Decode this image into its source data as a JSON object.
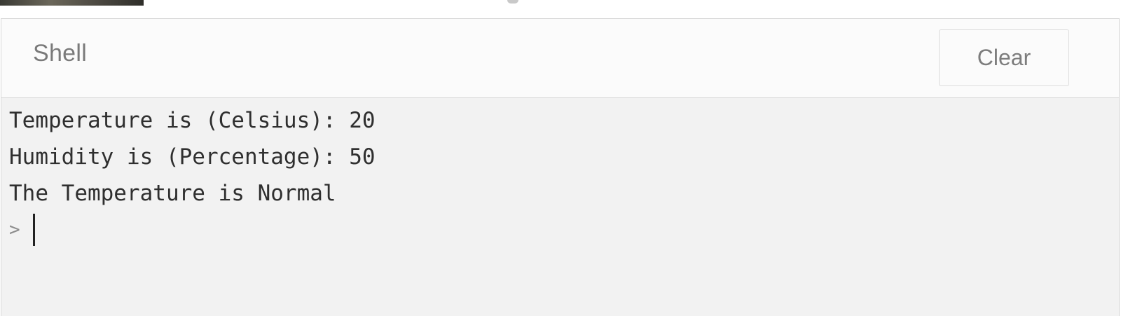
{
  "shell": {
    "title": "Shell",
    "clear_label": "Clear"
  },
  "console": {
    "lines": [
      "Temperature is (Celsius): 20",
      "Humidity is (Percentage): 50",
      "The Temperature is Normal"
    ],
    "prompt": ">",
    "input_value": ""
  },
  "colors": {
    "panel_bg": "#f2f2f2",
    "header_bg": "#fbfbfb",
    "border": "#d9d9d9",
    "text": "#2f2f2f",
    "muted_text": "#7a7a7a"
  }
}
